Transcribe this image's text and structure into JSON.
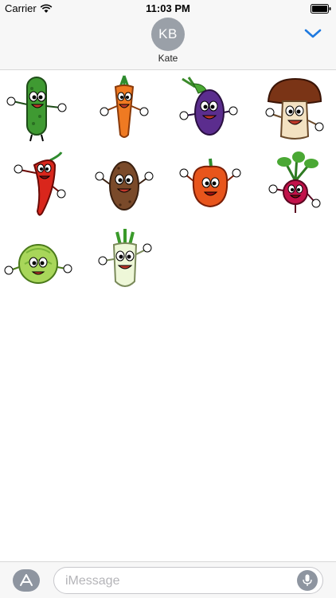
{
  "status_bar": {
    "carrier": "Carrier",
    "time": "11:03 PM",
    "wifi_icon": "wifi-icon",
    "battery_icon": "battery-icon"
  },
  "header": {
    "avatar_initials": "KB",
    "contact_name": "Kate",
    "collapse_icon": "chevron-down-icon",
    "accent_color": "#1f7ae0"
  },
  "stickers": [
    {
      "name": "cucumber",
      "icon": "cucumber-sticker"
    },
    {
      "name": "carrot",
      "icon": "carrot-sticker"
    },
    {
      "name": "eggplant",
      "icon": "eggplant-sticker"
    },
    {
      "name": "mushroom",
      "icon": "mushroom-sticker"
    },
    {
      "name": "chili pepper",
      "icon": "chili-pepper-sticker"
    },
    {
      "name": "potato",
      "icon": "potato-sticker"
    },
    {
      "name": "bell pepper",
      "icon": "bell-pepper-sticker"
    },
    {
      "name": "radish",
      "icon": "radish-sticker"
    },
    {
      "name": "cabbage",
      "icon": "cabbage-sticker"
    },
    {
      "name": "daikon",
      "icon": "daikon-sticker"
    }
  ],
  "composer": {
    "placeholder": "iMessage",
    "app_store_icon": "app-store-icon",
    "mic_icon": "microphone-icon"
  }
}
